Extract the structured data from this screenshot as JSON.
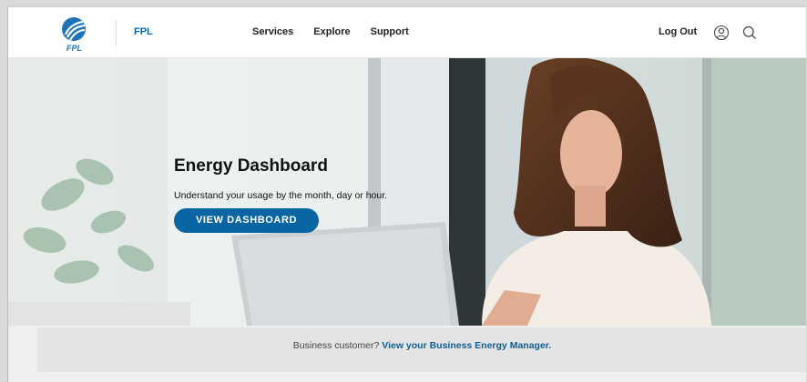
{
  "header": {
    "logo_text": "FPL",
    "brand_link": "FPL",
    "nav": [
      {
        "label": "Services"
      },
      {
        "label": "Explore"
      },
      {
        "label": "Support"
      }
    ],
    "logout": "Log Out",
    "icons": [
      "user-icon",
      "search-icon"
    ]
  },
  "hero": {
    "title": "Energy Dashboard",
    "subtitle": "Understand your usage by the month, day or hour.",
    "cta": "VIEW DASHBOARD"
  },
  "business": {
    "prefix": "Business customer?",
    "link": "View your Business Energy Manager."
  },
  "colors": {
    "brand_blue": "#0a66a3",
    "link_blue": "#0067a8",
    "text_dark": "#111111"
  }
}
